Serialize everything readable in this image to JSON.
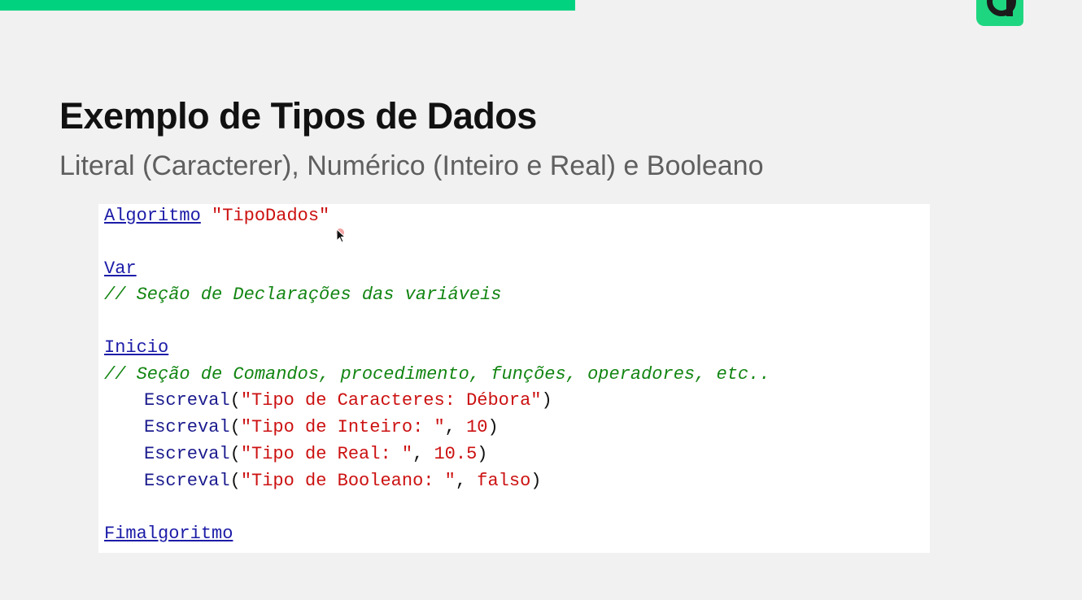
{
  "slide": {
    "title": "Exemplo de Tipos de Dados",
    "subtitle": "Literal (Caracterer), Numérico (Inteiro e Real) e Booleano"
  },
  "colors": {
    "accent": "#00d27f",
    "keyword": "#1c1ca8",
    "string": "#cc1111",
    "comment": "#128512"
  },
  "code": {
    "algoritmo_kw": "Algoritmo",
    "algoritmo_name": "\"TipoDados\"",
    "var_kw": "Var",
    "var_comment": "// Seção de Declarações das variáveis",
    "inicio_kw": "Inicio",
    "inicio_comment": "// Seção de Comandos, procedimento, funções, operadores, etc..",
    "statements": [
      {
        "fn": "Escreval",
        "open": "(",
        "str": "\"Tipo de Caracteres: Débora\"",
        "sep": "",
        "arg": "",
        "close": ")"
      },
      {
        "fn": "Escreval",
        "open": "(",
        "str": "\"Tipo de Inteiro: \"",
        "sep": ", ",
        "arg": "10",
        "close": ")"
      },
      {
        "fn": "Escreval",
        "open": "(",
        "str": "\"Tipo de Real: \"",
        "sep": ", ",
        "arg": "10.5",
        "close": ")"
      },
      {
        "fn": "Escreval",
        "open": "(",
        "str": "\"Tipo de Booleano: \"",
        "sep": ", ",
        "arg": "falso",
        "close": ")"
      }
    ],
    "fim_kw": "Fimalgoritmo"
  },
  "icons": {
    "logo": "brand-logo-icon",
    "cursor": "mouse-cursor-icon"
  }
}
